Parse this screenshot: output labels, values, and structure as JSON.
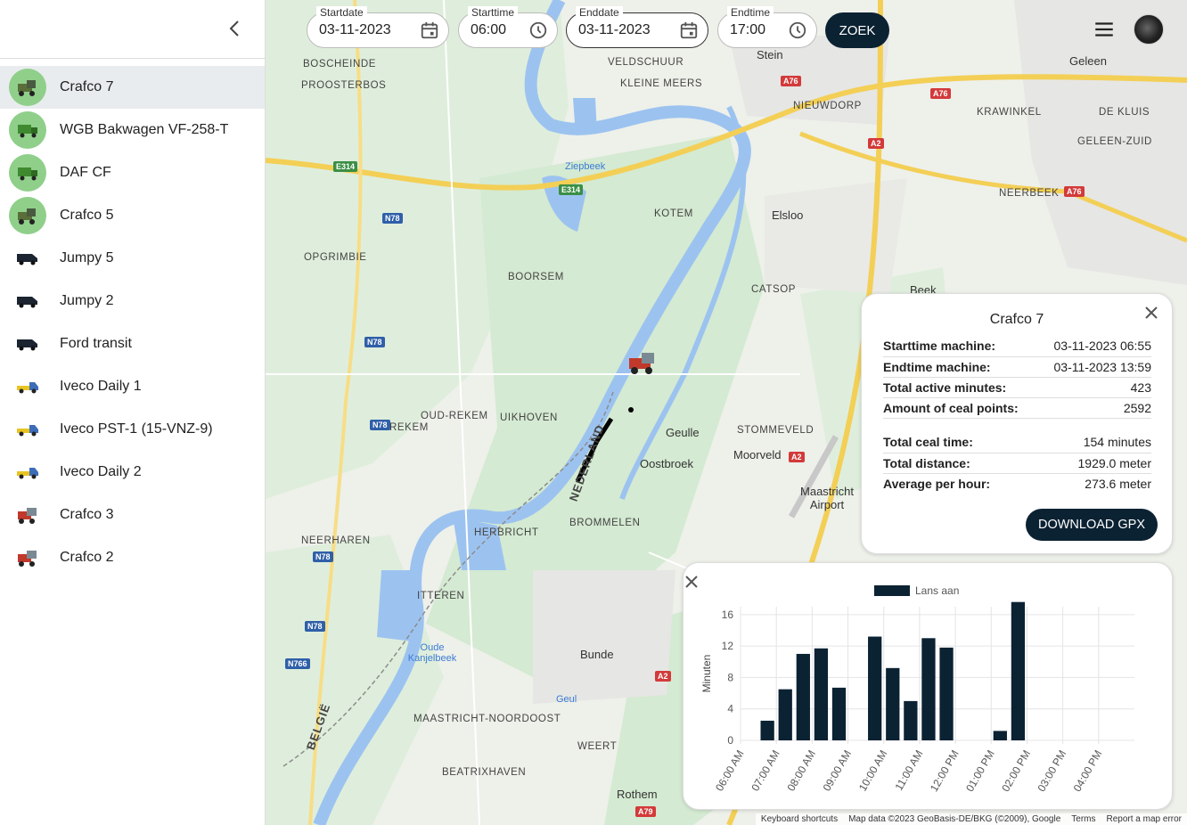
{
  "sidebar": {
    "vehicles": [
      {
        "label": "Crafco 7",
        "icon": "crafco-machine-icon",
        "active": true
      },
      {
        "label": "WGB Bakwagen VF-258-T",
        "icon": "green-truck-icon"
      },
      {
        "label": "DAF CF",
        "icon": "green-truck-icon"
      },
      {
        "label": "Crafco 5",
        "icon": "crafco-machine-icon"
      },
      {
        "label": "Jumpy 5",
        "icon": "van-icon"
      },
      {
        "label": "Jumpy 2",
        "icon": "van-icon"
      },
      {
        "label": "Ford transit",
        "icon": "van-icon"
      },
      {
        "label": "Iveco Daily 1",
        "icon": "pickup-icon"
      },
      {
        "label": "Iveco PST-1 (15-VNZ-9)",
        "icon": "pickup-icon"
      },
      {
        "label": "Iveco Daily 2",
        "icon": "pickup-icon"
      },
      {
        "label": "Crafco 3",
        "icon": "red-machine-icon"
      },
      {
        "label": "Crafco 2",
        "icon": "red-machine-icon"
      }
    ]
  },
  "filters": {
    "startdate": {
      "label": "Startdate",
      "value": "03-11-2023"
    },
    "starttime": {
      "label": "Starttime",
      "value": "06:00"
    },
    "enddate": {
      "label": "Enddate",
      "value": "03-11-2023"
    },
    "endtime": {
      "label": "Endtime",
      "value": "17:00"
    },
    "search_label": "ZOEK"
  },
  "info": {
    "title": "Crafco 7",
    "rows": [
      {
        "key": "Starttime machine:",
        "value": "03-11-2023 06:55"
      },
      {
        "key": "Endtime machine:",
        "value": "03-11-2023 13:59"
      },
      {
        "key": "Total active minutes:",
        "value": "423"
      },
      {
        "key": "Amount of ceal points:",
        "value": "2592"
      },
      {
        "key": "Total ceal time:",
        "value": "154 minutes"
      },
      {
        "key": "Total distance:",
        "value": "1929.0 meter"
      },
      {
        "key": "Average per hour:",
        "value": "273.6 meter"
      }
    ],
    "download_label": "DOWNLOAD GPX"
  },
  "chart_data": {
    "type": "bar",
    "title": "",
    "xlabel": "",
    "ylabel": "Minuten",
    "ylim": [
      0,
      17
    ],
    "yticks": [
      0,
      4,
      8,
      12,
      16
    ],
    "xticks": [
      "06:00 AM",
      "07:00 AM",
      "08:00 AM",
      "09:00 AM",
      "10:00 AM",
      "11:00 AM",
      "12:00 PM",
      "01:00 PM",
      "02:00 PM",
      "03:00 PM",
      "04:00 PM"
    ],
    "x_start_hour": 6,
    "bin_minutes": 30,
    "series": [
      {
        "name": "Lans aan",
        "color": "#0b2233",
        "values": [
          0,
          2.5,
          6.5,
          11,
          11.7,
          6.7,
          0,
          13.2,
          9.2,
          5,
          13,
          11.8,
          0,
          0,
          1.2,
          17.6,
          0,
          0,
          0,
          0,
          0,
          0
        ]
      }
    ],
    "grid": true,
    "legend": "top-center"
  },
  "map": {
    "labels": [
      {
        "text": "BOSCHEINDE",
        "cls": ""
      },
      {
        "text": "PROOSTERBOS",
        "cls": ""
      },
      {
        "text": "VELDSCHUUR",
        "cls": ""
      },
      {
        "text": "KLEINE MEERS",
        "cls": ""
      },
      {
        "text": "Stein",
        "cls": "town"
      },
      {
        "text": "NIEUWDORP",
        "cls": ""
      },
      {
        "text": "Geleen",
        "cls": "town"
      },
      {
        "text": "KRAWINKEL",
        "cls": ""
      },
      {
        "text": "DE KLUIS",
        "cls": ""
      },
      {
        "text": "GELEEN-ZUID",
        "cls": ""
      },
      {
        "text": "Ziepbeek",
        "cls": "water"
      },
      {
        "text": "KOTEM",
        "cls": ""
      },
      {
        "text": "Elsloo",
        "cls": "town"
      },
      {
        "text": "NEERBEEK",
        "cls": ""
      },
      {
        "text": "OPGRIMBIE",
        "cls": ""
      },
      {
        "text": "BOORSEM",
        "cls": ""
      },
      {
        "text": "CATSOP",
        "cls": ""
      },
      {
        "text": "Beek",
        "cls": "town"
      },
      {
        "text": "OUD-REKEM",
        "cls": ""
      },
      {
        "text": "UIKHOVEN",
        "cls": ""
      },
      {
        "text": "REKEM",
        "cls": ""
      },
      {
        "text": "Geulle",
        "cls": "town"
      },
      {
        "text": "STOMMEVELD",
        "cls": ""
      },
      {
        "text": "Oostbroek",
        "cls": "town"
      },
      {
        "text": "Moorveld",
        "cls": "town"
      },
      {
        "text": "Maastricht Airport",
        "cls": "town"
      },
      {
        "text": "BROMMELEN",
        "cls": ""
      },
      {
        "text": "HERBRICHT",
        "cls": ""
      },
      {
        "text": "NEERHAREN",
        "cls": ""
      },
      {
        "text": "ITTEREN",
        "cls": ""
      },
      {
        "text": "Bunde",
        "cls": "town"
      },
      {
        "text": "Oude Kanjelbeek",
        "cls": "water"
      },
      {
        "text": "MAASTRICHT-NOORDOOST",
        "cls": ""
      },
      {
        "text": "Geul",
        "cls": "water"
      },
      {
        "text": "WEERT",
        "cls": ""
      },
      {
        "text": "BEATRIXHAVEN",
        "cls": ""
      },
      {
        "text": "Rothem",
        "cls": "town"
      },
      {
        "text": "BELGIË",
        "cls": "border"
      },
      {
        "text": "NEDERLAND",
        "cls": "border"
      }
    ],
    "shields": [
      {
        "text": "E314",
        "color": "green"
      },
      {
        "text": "E314",
        "color": "green"
      },
      {
        "text": "A76",
        "color": "red"
      },
      {
        "text": "A76",
        "color": "red"
      },
      {
        "text": "A2",
        "color": "red"
      },
      {
        "text": "A76",
        "color": "red"
      },
      {
        "text": "N78",
        "color": "blue"
      },
      {
        "text": "N78",
        "color": "blue"
      },
      {
        "text": "N78",
        "color": "blue"
      },
      {
        "text": "N78",
        "color": "blue"
      },
      {
        "text": "N78",
        "color": "blue"
      },
      {
        "text": "N766",
        "color": "blue"
      },
      {
        "text": "A2",
        "color": "red"
      },
      {
        "text": "A2",
        "color": "red"
      },
      {
        "text": "A79",
        "color": "red"
      }
    ],
    "attribution": [
      "Keyboard shortcuts",
      "Map data ©2023 GeoBasis-DE/BKG (©2009), Google",
      "Terms",
      "Report a map error"
    ]
  }
}
